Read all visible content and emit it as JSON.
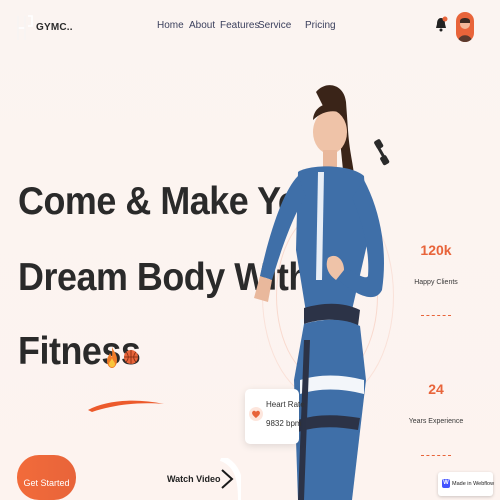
{
  "brand": {
    "logo_text": "GYMC.."
  },
  "nav": {
    "items": [
      {
        "label": "Home"
      },
      {
        "label": "About"
      },
      {
        "label": "Features"
      },
      {
        "label": "Service"
      },
      {
        "label": "Pricing"
      }
    ]
  },
  "header": {
    "bell_icon": "bell-icon",
    "avatar": "user-avatar"
  },
  "hero": {
    "headline_lines": [
      "Come & Make Your",
      "Dream Body With",
      "Fitness"
    ],
    "emoji_icons": [
      "fire-icon",
      "basketball-icon"
    ],
    "cta_label": "Get Started",
    "watch_label": "Watch Video"
  },
  "stats": [
    {
      "value": "120k",
      "label": "Happy Clients"
    },
    {
      "value": "24",
      "label": "Years Experience"
    }
  ],
  "heart_card": {
    "title": "Heart Rate",
    "value": "9832 bpm"
  },
  "badge": {
    "label": "Made in Webflow"
  },
  "colors": {
    "accent": "#e8643a",
    "text": "#2a2a2a",
    "nav": "#3a3f5c",
    "suit": "#3f6fa8"
  }
}
